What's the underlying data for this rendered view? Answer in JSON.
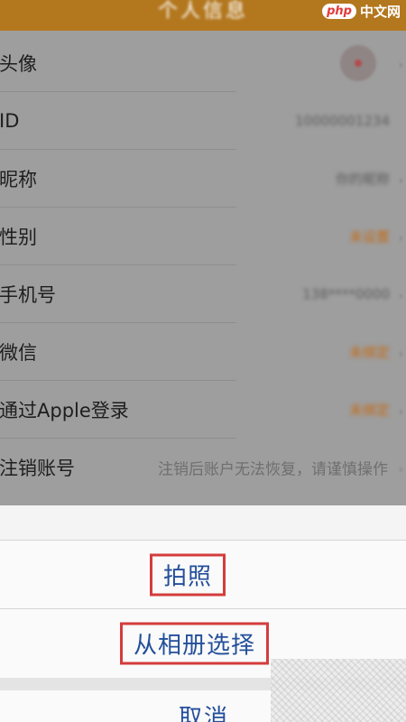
{
  "header": {
    "title": "个人信息",
    "watermark_logo": "php",
    "watermark_text": "中文网"
  },
  "profile": {
    "rows": [
      {
        "label": "头像",
        "value": ""
      },
      {
        "label": "ID",
        "value": "10000001234"
      },
      {
        "label": "昵称",
        "value": "你的昵称"
      },
      {
        "label": "性别",
        "value": "未设置"
      },
      {
        "label": "手机号",
        "value": "138****0000"
      },
      {
        "label": "微信",
        "value": "未绑定"
      },
      {
        "label": "通过Apple登录",
        "value": "未绑定"
      },
      {
        "label": "注销账号",
        "value": "注销后账户无法恢复，请谨慎操作"
      }
    ],
    "chevron": "›",
    "chevron_icon": "chevron-right-icon",
    "avatar_icon": "avatar-image"
  },
  "action_sheet": {
    "take_photo_label": "拍照",
    "choose_album_label": "从相册选择",
    "cancel_label": "取消",
    "highlight_color": "#d43c3c",
    "text_color": "#244f9a"
  }
}
